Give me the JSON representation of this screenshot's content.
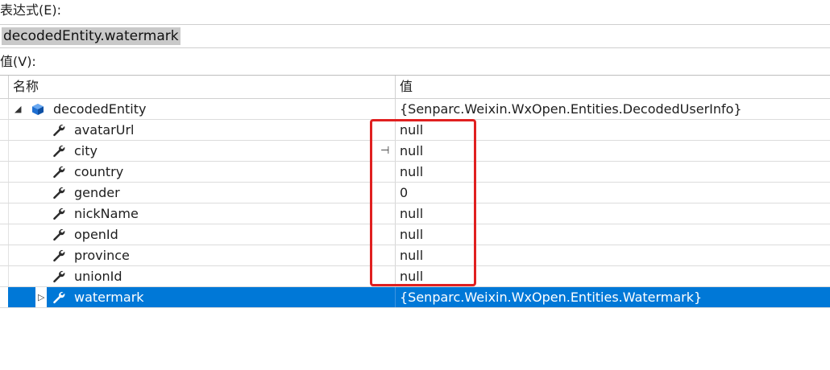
{
  "expression": {
    "label": "表达式(E):",
    "value": "decodedEntity.watermark"
  },
  "value_section": {
    "label": "值(V):"
  },
  "columns": {
    "name": "名称",
    "value": "值"
  },
  "rows": [
    {
      "name": "decodedEntity",
      "value": "{Senparc.Weixin.WxOpen.Entities.DecodedUserInfo}",
      "expander": "◢",
      "icon": "object-icon"
    },
    {
      "name": "avatarUrl",
      "value": "null",
      "icon": "wrench-icon"
    },
    {
      "name": "city",
      "value": "null",
      "icon": "wrench-icon",
      "pin": "⊣"
    },
    {
      "name": "country",
      "value": "null",
      "icon": "wrench-icon"
    },
    {
      "name": "gender",
      "value": "0",
      "icon": "wrench-icon"
    },
    {
      "name": "nickName",
      "value": "null",
      "icon": "wrench-icon"
    },
    {
      "name": "openId",
      "value": "null",
      "icon": "wrench-icon"
    },
    {
      "name": "province",
      "value": "null",
      "icon": "wrench-icon"
    },
    {
      "name": "unionId",
      "value": "null",
      "icon": "wrench-icon"
    },
    {
      "name": "watermark",
      "value": "{Senparc.Weixin.WxOpen.Entities.Watermark}",
      "expander": "▷",
      "icon": "wrench-icon",
      "selected": true
    }
  ],
  "colors": {
    "selection": "#0078d7",
    "highlight_box": "#e02020"
  }
}
